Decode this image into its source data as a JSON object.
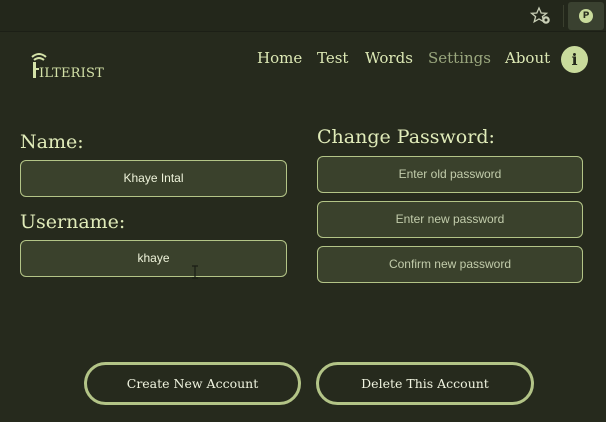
{
  "browser": {
    "star_icon": "star-gear-icon",
    "profile_icon": "profile-icon",
    "profile_initial": "P"
  },
  "header": {
    "logo_text": "ILTERIST",
    "logo_icon": "filter-logo-icon",
    "nav": [
      "Home",
      "Test",
      "Words",
      "Settings",
      "About"
    ],
    "active_nav": "Settings",
    "info_icon": "info-icon",
    "info_glyph": "i"
  },
  "profile": {
    "name_label": "Name:",
    "name_value": "Khaye Intal",
    "username_label": "Username:",
    "username_value": "khaye"
  },
  "password": {
    "title": "Change Password:",
    "old_placeholder": "Enter old password",
    "new_placeholder": "Enter new password",
    "confirm_placeholder": "Confirm new password"
  },
  "actions": {
    "create": "Create New Account",
    "delete": "Delete This Account"
  },
  "colors": {
    "background": "#262a1d",
    "accent": "#c9db9c",
    "field_bg": "#3a412c",
    "border": "#b3c487"
  }
}
